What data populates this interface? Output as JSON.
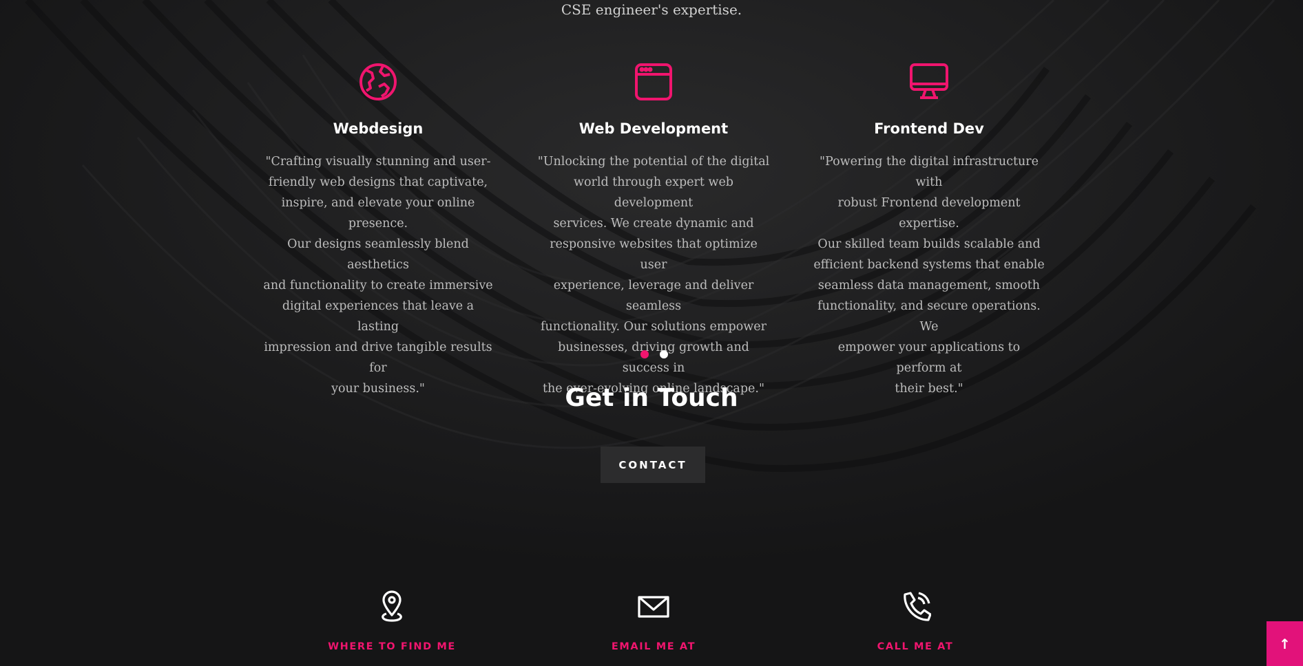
{
  "intro": {
    "tail_text": "CSE engineer's expertise."
  },
  "services": [
    {
      "icon": "globe-icon",
      "title": "Webdesign",
      "lines": [
        "\"Crafting visually stunning and user-",
        "friendly web designs that captivate,",
        "inspire, and elevate your online presence.",
        "Our designs seamlessly blend aesthetics",
        "and functionality to create immersive",
        "digital experiences that leave a lasting",
        "impression and drive tangible results for",
        "your business.\""
      ]
    },
    {
      "icon": "browser-window-icon",
      "title": "Web Development",
      "lines": [
        "\"Unlocking the potential of the digital",
        "world through expert web development",
        "services. We create dynamic and",
        "responsive websites that optimize user",
        "experience, leverage and deliver seamless",
        "functionality. Our solutions empower",
        "businesses, driving growth and success in",
        "the ever-evolving online landscape.\""
      ]
    },
    {
      "icon": "monitor-icon",
      "title": "Frontend Dev",
      "lines": [
        "\"Powering the digital infrastructure with",
        "robust Frontend development expertise.",
        "Our skilled team builds scalable and",
        "efficient backend systems that enable",
        "seamless data management, smooth",
        "functionality, and secure operations. We",
        "empower your applications to perform at",
        "their best.\""
      ]
    }
  ],
  "carousel": {
    "active_index": 0,
    "count": 2
  },
  "touch": {
    "title": "Get in Touch",
    "button_label": "CONTACT"
  },
  "contact_info": [
    {
      "icon": "map-pin-icon",
      "label": "WHERE TO FIND ME"
    },
    {
      "icon": "envelope-icon",
      "label": "EMAIL ME AT"
    },
    {
      "icon": "phone-icon",
      "label": "CALL ME AT"
    }
  ],
  "back_to_top": {
    "label": "↑"
  },
  "colors": {
    "accent": "#f0156e",
    "background": "#151516",
    "button": "#2c2c2d"
  }
}
